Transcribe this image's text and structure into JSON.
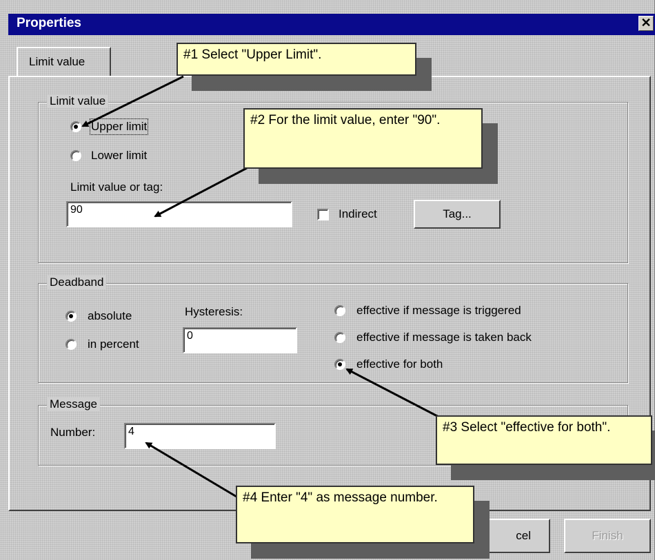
{
  "window": {
    "title": "Properties",
    "close_glyph": "✕",
    "close_icon": "close-icon"
  },
  "tabs": [
    {
      "label": "Limit value",
      "selected": true
    }
  ],
  "limit_group": {
    "legend": "Limit value",
    "upper_label": "Upper limit",
    "upper_checked": true,
    "lower_label": "Lower limit",
    "lower_checked": false,
    "field_label": "Limit value or tag:",
    "value": "90",
    "indirect_label": "Indirect",
    "indirect_checked": false,
    "tag_button": "Tag..."
  },
  "deadband_group": {
    "legend": "Deadband",
    "absolute_label": "absolute",
    "absolute_checked": true,
    "percent_label": "in percent",
    "percent_checked": false,
    "hysteresis_label": "Hysteresis:",
    "hysteresis_value": "0",
    "options": [
      {
        "label": "effective if message is triggered",
        "checked": false
      },
      {
        "label": "effective if message is taken back",
        "checked": false
      },
      {
        "label": "effective for both",
        "checked": true
      }
    ]
  },
  "message_group": {
    "legend": "Message",
    "number_label": "Number:",
    "number_value": "4"
  },
  "buttons": {
    "cancel_visible": "cel",
    "finish": "Finish",
    "finish_enabled": false
  },
  "callouts": {
    "c1": "#1 Select \"Upper Limit\".",
    "c2": "#2 For the limit value, enter \"90\".",
    "c3": "#3 Select \"effective for both\".",
    "c4": "#4 Enter  \"4\" as message number."
  },
  "colors": {
    "titlebar": "#0a0a8c",
    "callout_bg": "#ffffc4",
    "callout_shadow": "#5e5e5e",
    "dialog_bg": "#d0d0d0"
  }
}
